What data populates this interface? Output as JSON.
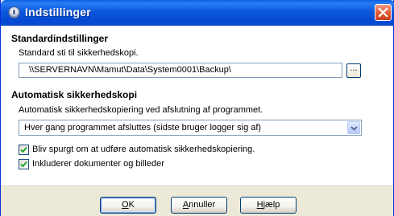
{
  "window": {
    "title": "Indstillinger",
    "icons": {
      "app": "app-icon",
      "close": "close-icon"
    }
  },
  "standard": {
    "heading": "Standardindstillinger",
    "path_label": "Standard sti til sikkerhedskopi.",
    "path_value": "\\\\SERVERNAVN\\Mamut\\Data\\System0001\\Backup\\",
    "browse_label": "..."
  },
  "auto": {
    "heading": "Automatisk sikkerhedskopi",
    "description": "Automatisk sikkerhedskopiering ved afslutning af programmet.",
    "selected_option": "Hver gang programmet afsluttes (sidste bruger logger sig af)",
    "checkboxes": [
      {
        "label": "Bliv spurgt om at udføre automatisk sikkerhedskopiering.",
        "checked": true
      },
      {
        "label": "Inkluderer dokumenter og billeder",
        "checked": true
      }
    ]
  },
  "buttons": {
    "ok": {
      "mnemonic": "O",
      "rest": "K"
    },
    "cancel": {
      "mnemonic": "A",
      "rest": "nnuller"
    },
    "help": {
      "mnemonic": "H",
      "rest": "jælp"
    }
  },
  "colors": {
    "titlebar": "#0a58dd",
    "footer": "#ece9d8",
    "close": "#e1542e"
  }
}
